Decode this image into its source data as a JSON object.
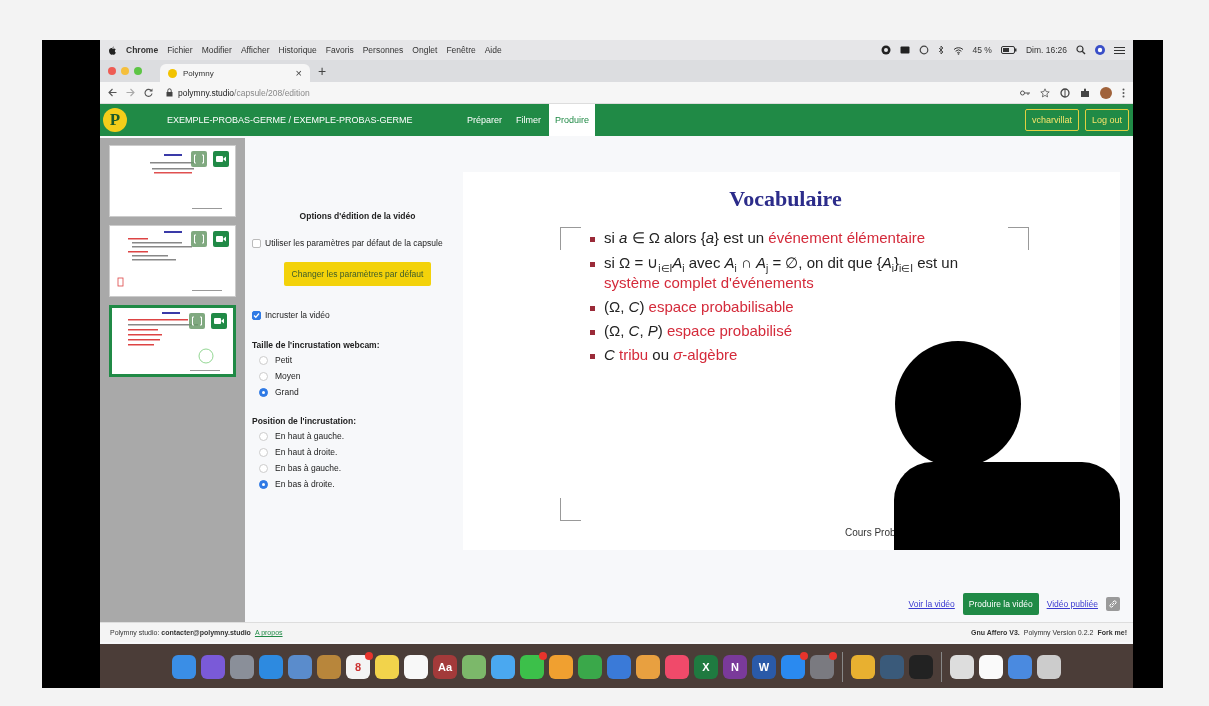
{
  "menubar": {
    "app": "Chrome",
    "menus": [
      "Fichier",
      "Modifier",
      "Afficher",
      "Historique",
      "Favoris",
      "Personnes",
      "Onglet",
      "Fenêtre",
      "Aide"
    ],
    "battery": "45 %",
    "clock": "Dim. 16:26"
  },
  "browser": {
    "tab": {
      "title": "Polymny",
      "close": "×"
    },
    "new_tab": "+",
    "address": {
      "host": "polymny.studio",
      "path": "/capsule/208/edition"
    }
  },
  "nav": {
    "logo": "P",
    "title": "EXEMPLE-PROBAS-GERME / EXEMPLE-PROBAS-GERME",
    "tabs": [
      {
        "label": "Préparer",
        "selected": false
      },
      {
        "label": "Filmer",
        "selected": false
      },
      {
        "label": "Produire",
        "selected": true
      }
    ],
    "user": "vcharvillat",
    "logout": "Log out"
  },
  "thumbnails": [
    {
      "selected": false
    },
    {
      "selected": false
    },
    {
      "selected": true
    }
  ],
  "options": {
    "title": "Options d'édition de la vidéo",
    "use_defaults": {
      "label": "Utiliser les paramètres par défaut de la capsule",
      "checked": false
    },
    "change_defaults": "Changer les paramètres par défaut",
    "embed": {
      "label": "Incruster la vidéo",
      "checked": true
    },
    "size": {
      "heading": "Taille de l'incrustation webcam:",
      "options": [
        {
          "label": "Petit",
          "selected": false
        },
        {
          "label": "Moyen",
          "selected": false
        },
        {
          "label": "Grand",
          "selected": true
        }
      ]
    },
    "position": {
      "heading": "Position de l'incrustation:",
      "options": [
        {
          "label": "En haut à gauche.",
          "selected": false
        },
        {
          "label": "En haut à droite.",
          "selected": false
        },
        {
          "label": "En bas à gauche.",
          "selected": false
        },
        {
          "label": "En bas à droite.",
          "selected": true
        }
      ]
    }
  },
  "slide": {
    "title": "Vocabulaire",
    "bullets": [
      {
        "parts": [
          {
            "text": "si *a* ∈ Ω alors {*a*} est un ",
            "highlight": false
          },
          {
            "text": "événement élémentaire",
            "highlight": true
          }
        ]
      },
      {
        "parts": [
          {
            "text": "si Ω = ∪$_{i∈I}$*A*$_{i}$ avec *A*$_{i}$ ∩ *A*$_{j}$ = ∅, on dit que {*A*$_{i}$}$_{i∈I}$ est un ",
            "highlight": false
          },
          {
            "text": "système complet d'événements",
            "highlight": true
          }
        ]
      },
      {
        "parts": [
          {
            "text": "(Ω, *C*) ",
            "highlight": false
          },
          {
            "text": "espace probabilisable",
            "highlight": true
          }
        ]
      },
      {
        "parts": [
          {
            "text": "(Ω, *C*, *P*) ",
            "highlight": false
          },
          {
            "text": "espace probabilisé",
            "highlight": true
          }
        ]
      },
      {
        "parts": [
          {
            "text": "*C* ",
            "highlight": false
          },
          {
            "text": "tribu",
            "highlight": true
          },
          {
            "text": " ou ",
            "highlight": false
          },
          {
            "text": "*σ*-algèbre",
            "highlight": true
          }
        ]
      }
    ],
    "footer": "Cours Prob"
  },
  "actions": {
    "view": "Voir la vidéo",
    "produce": "Produire la vidéo",
    "published": "Vidéo publiée"
  },
  "footer": {
    "contact": "Polymny studio: **contacter@polymny.studio**",
    "about": "A propos",
    "license": "Gnu Affero V3.",
    "version": "Polymny Version 0.2.2",
    "fork": "Fork me!"
  },
  "dock": [
    {
      "kind": "app",
      "color": "#3a8ee6",
      "badge": false
    },
    {
      "kind": "app",
      "color": "#7a5ad8",
      "badge": false
    },
    {
      "kind": "app",
      "color": "#8a8f99",
      "badge": false
    },
    {
      "kind": "app",
      "color": "#2d8ae0",
      "badge": false
    },
    {
      "kind": "app",
      "color": "#5a8ccc",
      "badge": false
    },
    {
      "kind": "app",
      "color": "#b8863b",
      "badge": false
    },
    {
      "kind": "app",
      "color": "#f4f4f4",
      "badge": true,
      "label": "8"
    },
    {
      "kind": "app",
      "color": "#f2d34b",
      "badge": false
    },
    {
      "kind": "app",
      "color": "#f8f8f8",
      "badge": false
    },
    {
      "kind": "app",
      "color": "#a33a3a",
      "badge": false,
      "label": "Aa"
    },
    {
      "kind": "app",
      "color": "#7cb86a",
      "badge": false
    },
    {
      "kind": "app",
      "color": "#4aa8f0",
      "badge": false
    },
    {
      "kind": "app",
      "color": "#3cc04a",
      "badge": true
    },
    {
      "kind": "app",
      "color": "#f0a030",
      "badge": false
    },
    {
      "kind": "app",
      "color": "#3aa84a",
      "badge": false
    },
    {
      "kind": "app",
      "color": "#3a7ad8",
      "badge": false
    },
    {
      "kind": "app",
      "color": "#e8a040",
      "badge": false
    },
    {
      "kind": "app",
      "color": "#f04a6a",
      "badge": false
    },
    {
      "kind": "app",
      "color": "#1f7a40",
      "badge": false,
      "label": "X"
    },
    {
      "kind": "app",
      "color": "#7a3a9a",
      "badge": false,
      "label": "N"
    },
    {
      "kind": "app",
      "color": "#2a5aa8",
      "badge": false,
      "label": "W"
    },
    {
      "kind": "app",
      "color": "#2a8af0",
      "badge": true
    },
    {
      "kind": "app",
      "color": "#7a7a80",
      "badge": true
    },
    {
      "kind": "separator"
    },
    {
      "kind": "app",
      "color": "#e8b030",
      "badge": false
    },
    {
      "kind": "app",
      "color": "#3a5a7a",
      "badge": false
    },
    {
      "kind": "app",
      "color": "#222222",
      "badge": false
    },
    {
      "kind": "separator"
    },
    {
      "kind": "app",
      "color": "#dddddd",
      "badge": false
    },
    {
      "kind": "app",
      "color": "#fafafa",
      "badge": false
    },
    {
      "kind": "app",
      "color": "#4a8ae0",
      "badge": false
    },
    {
      "kind": "app",
      "color": "#cccccc",
      "badge": false
    }
  ]
}
